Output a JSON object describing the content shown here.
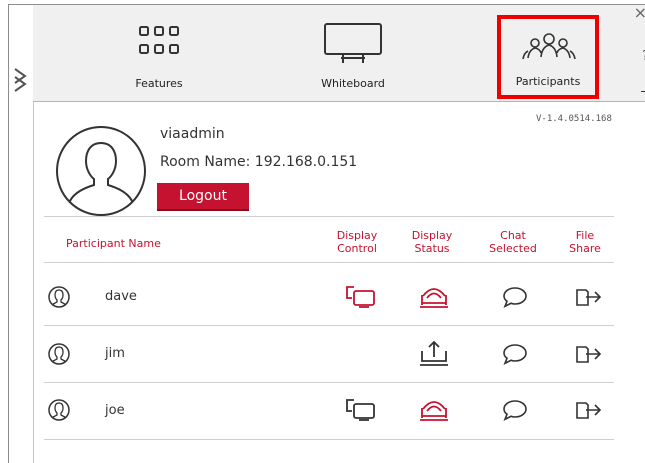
{
  "toolbar": {
    "features_label": "Features",
    "whiteboard_label": "Whiteboard",
    "participants_label": "Participants",
    "close_glyph": "×",
    "help_glyph": "?"
  },
  "profile": {
    "version": "V-1.4.0514.168",
    "username": "viaadmin",
    "room_name": "Room Name: 192.168.0.151",
    "logout_label": "Logout"
  },
  "table": {
    "headers": {
      "name": "Participant Name",
      "display_control": [
        "Display",
        "Control"
      ],
      "display_status": [
        "Display",
        "Status"
      ],
      "chat_selected": [
        "Chat",
        "Selected"
      ],
      "file_share": [
        "File",
        "Share"
      ]
    },
    "rows": [
      {
        "name": "dave",
        "display_control": true,
        "display_status": "active",
        "chat": true,
        "file_share": true
      },
      {
        "name": "jim",
        "display_control": false,
        "display_status": "upload",
        "chat": true,
        "file_share": true
      },
      {
        "name": "joe",
        "display_control": true,
        "display_status": "active",
        "chat": true,
        "file_share": true
      }
    ]
  },
  "colors": {
    "accent": "#c41230",
    "highlight_border": "#ee0000",
    "toolbar_bg": "#f0f0f0",
    "icon_dark": "#333333"
  }
}
